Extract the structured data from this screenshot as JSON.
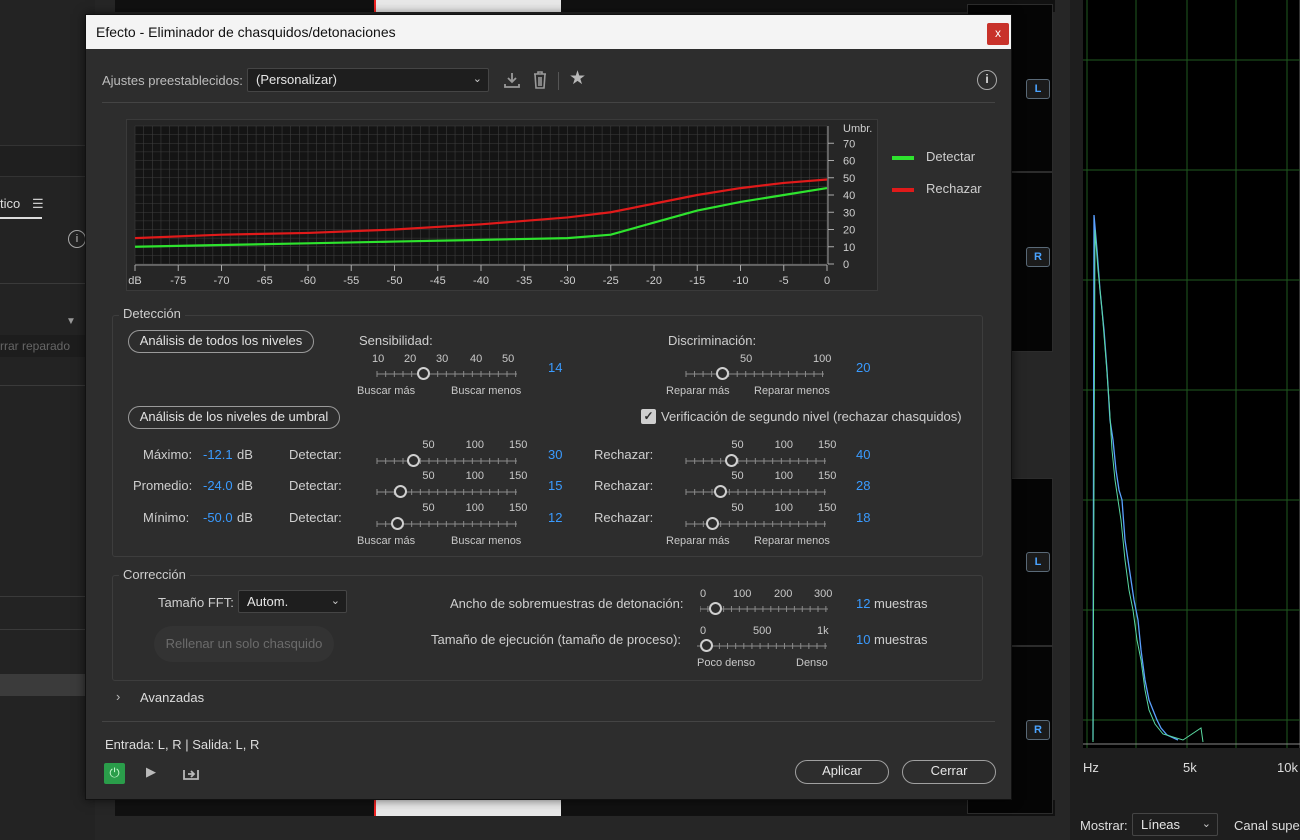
{
  "dialog": {
    "title": "Efecto - Eliminador de chasquidos/detonaciones",
    "close_label": "x",
    "presets_label": "Ajustes preestablecidos:",
    "preset_value": "(Personalizar)"
  },
  "graph": {
    "x_ticks": [
      "dB",
      "-75",
      "-70",
      "-65",
      "-60",
      "-55",
      "-50",
      "-45",
      "-40",
      "-35",
      "-30",
      "-25",
      "-20",
      "-15",
      "-10",
      "-5",
      "0"
    ],
    "y_title": "Umbr.",
    "y_ticks": [
      "70",
      "60",
      "50",
      "40",
      "30",
      "20",
      "10",
      "0"
    ],
    "legend": [
      {
        "name": "Detectar",
        "color": "#2ee32e"
      },
      {
        "name": "Rechazar",
        "color": "#e01a1a"
      }
    ]
  },
  "chart_data": {
    "type": "line",
    "x": [
      -80,
      -70,
      -60,
      -50,
      -40,
      -30,
      -25,
      -20,
      -15,
      -10,
      -5,
      0
    ],
    "series": [
      {
        "name": "Detectar",
        "values": [
          10,
          11,
          12,
          13,
          14,
          15,
          17,
          24,
          31,
          36,
          40,
          44
        ]
      },
      {
        "name": "Rechazar",
        "values": [
          15,
          17,
          18,
          20,
          23,
          27,
          30,
          35,
          40,
          44,
          47,
          49
        ]
      }
    ],
    "ylim": [
      0,
      80
    ],
    "xlim": [
      -80,
      0
    ],
    "grid": true,
    "legend": "right"
  },
  "detection": {
    "title": "Detección",
    "all_levels_btn": "Análisis de todos los niveles",
    "threshold_btn": "Análisis de los niveles de umbral",
    "sensitivity_label": "Sensibilidad:",
    "sensitivity_ticks": [
      "10",
      "20",
      "30",
      "40",
      "50"
    ],
    "sensitivity_value": "14",
    "sens_left": "Buscar más",
    "sens_right": "Buscar menos",
    "discrimination_label": "Discriminación:",
    "discrimination_ticks": [
      "50",
      "100"
    ],
    "discrimination_value": "20",
    "disc_left": "Reparar más",
    "disc_right": "Reparar menos",
    "second_level_label": "Verificación de segundo nivel (rechazar chasquidos)",
    "second_level_checked": true,
    "rows": [
      {
        "label": "Máximo:",
        "value": "-12.1",
        "unit": "dB",
        "detect_label": "Detectar:",
        "detect_value": "30",
        "reject_label": "Rechazar:",
        "reject_value": "40"
      },
      {
        "label": "Promedio:",
        "value": "-24.0",
        "unit": "dB",
        "detect_label": "Detectar:",
        "detect_value": "15",
        "reject_label": "Rechazar:",
        "reject_value": "28"
      },
      {
        "label": "Mínimo:",
        "value": "-50.0",
        "unit": "dB",
        "detect_label": "Detectar:",
        "detect_value": "12",
        "reject_label": "Rechazar:",
        "reject_value": "18"
      }
    ],
    "scale_ticks": [
      "50",
      "100",
      "150"
    ],
    "detect_left": "Buscar más",
    "detect_right": "Buscar menos",
    "reject_left": "Reparar más",
    "reject_right": "Reparar menos"
  },
  "correction": {
    "title": "Corrección",
    "fft_label": "Tamaño FFT:",
    "fft_value": "Autom.",
    "fill_btn": "Rellenar un solo chasquido",
    "pop_label": "Ancho de sobremuestras de detonación:",
    "pop_ticks": [
      "0",
      "100",
      "200",
      "300"
    ],
    "pop_value": "12",
    "pop_unit": "muestras",
    "run_label": "Tamaño de ejecución (tamaño de proceso):",
    "run_ticks": [
      "0",
      "500",
      "1k"
    ],
    "run_value": "10",
    "run_unit": "muestras",
    "run_left": "Poco denso",
    "run_right": "Denso"
  },
  "advanced_label": "Avanzadas",
  "io_label": "Entrada: L, R | Salida: L, R",
  "apply_label": "Aplicar",
  "close_button_label": "Cerrar",
  "background": {
    "tab_label": "tico",
    "reparado_label": "rrar reparado",
    "db_label": "dB",
    "channel_labels": [
      "L",
      "R",
      "L",
      "R"
    ],
    "spectrum_ticks": [
      "Hz",
      "5k",
      "10k"
    ],
    "show_label": "Mostrar:",
    "show_value": "Líneas",
    "channel_label": "Canal super"
  }
}
